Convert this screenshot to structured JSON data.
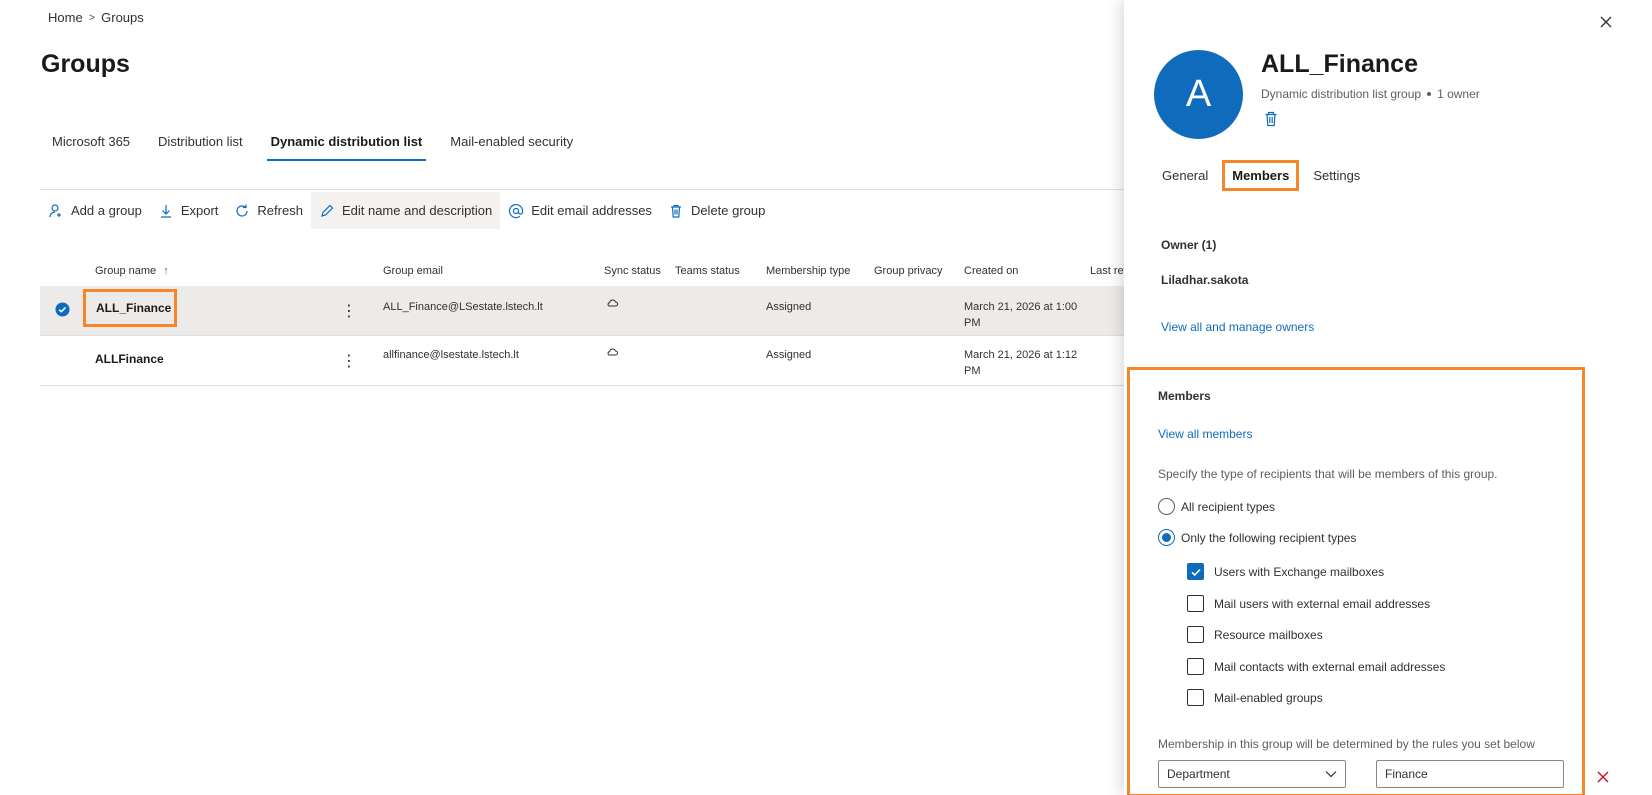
{
  "breadcrumb": {
    "home": "Home",
    "separator": ">",
    "current": "Groups"
  },
  "page_title": "Groups",
  "tabs": [
    {
      "label": "Microsoft 365",
      "active": false
    },
    {
      "label": "Distribution list",
      "active": false
    },
    {
      "label": "Dynamic distribution list",
      "active": true
    },
    {
      "label": "Mail-enabled security",
      "active": false
    }
  ],
  "toolbar": {
    "add_group": "Add a group",
    "export": "Export",
    "refresh": "Refresh",
    "edit_name": "Edit name and description",
    "edit_email": "Edit email addresses",
    "delete_group": "Delete group"
  },
  "table": {
    "columns": {
      "group_name": "Group name",
      "group_email": "Group email",
      "sync_status": "Sync status",
      "teams_status": "Teams status",
      "membership_type": "Membership type",
      "group_privacy": "Group privacy",
      "created_on": "Created on",
      "last_ref": "Last ref"
    },
    "rows": [
      {
        "name": "ALL_Finance",
        "email": "ALL_Finance@LSestate.lstech.lt",
        "membership": "Assigned",
        "created_line1": "March 21, 2026 at 1:00",
        "created_line2": "PM",
        "selected": true
      },
      {
        "name": "ALLFinance",
        "email": "allfinance@lsestate.lstech.lt",
        "membership": "Assigned",
        "created_line1": "March 21, 2026 at 1:12",
        "created_line2": "PM",
        "selected": false
      }
    ]
  },
  "panel": {
    "avatar_letter": "A",
    "title": "ALL_Finance",
    "subtitle": "Dynamic distribution list group",
    "owner_count": "1 owner",
    "tabs": [
      "General",
      "Members",
      "Settings"
    ],
    "active_tab": "Members",
    "owner_heading": "Owner (1)",
    "owner_name": "Liladhar.sakota",
    "owners_link": "View all and manage owners",
    "members_heading": "Members",
    "members_link": "View all members",
    "recipient_desc": "Specify the type of recipients that will be members of this group.",
    "radio_all": "All recipient types",
    "radio_only": "Only the following recipient types",
    "checkboxes": [
      {
        "label": "Users with Exchange mailboxes",
        "checked": true
      },
      {
        "label": "Mail users with external email addresses",
        "checked": false
      },
      {
        "label": "Resource mailboxes",
        "checked": false
      },
      {
        "label": "Mail contacts with external email addresses",
        "checked": false
      },
      {
        "label": "Mail-enabled groups",
        "checked": false
      }
    ],
    "rules_desc": "Membership in this group will be determined by the rules you set below",
    "rule_attribute": "Department",
    "rule_value": "Finance"
  },
  "colors": {
    "accent": "#0f6cbd",
    "highlight": "#f7862b",
    "selected_row": "#edebe9"
  }
}
